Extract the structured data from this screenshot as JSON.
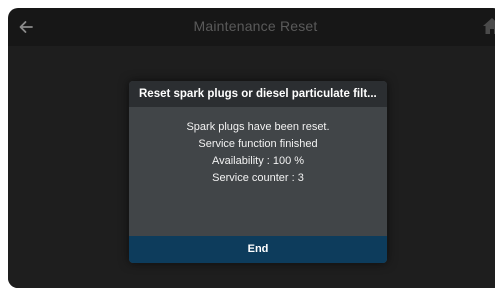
{
  "header": {
    "title": "Maintenance Reset",
    "back_icon": "arrow-left-icon",
    "home_icon": "home-icon"
  },
  "dialog": {
    "title": "Reset spark plugs or diesel particulate filt...",
    "lines": [
      "Spark plugs have been reset.",
      "Service function finished",
      "Availability : 100 %",
      "Service counter : 3"
    ],
    "end_label": "End"
  },
  "colors": {
    "background": "#171717",
    "dialog": "#414548",
    "dialog_title_bar": "#2b2e31",
    "end_button": "#0d3c5c",
    "header_title": "#5a5a5a"
  }
}
